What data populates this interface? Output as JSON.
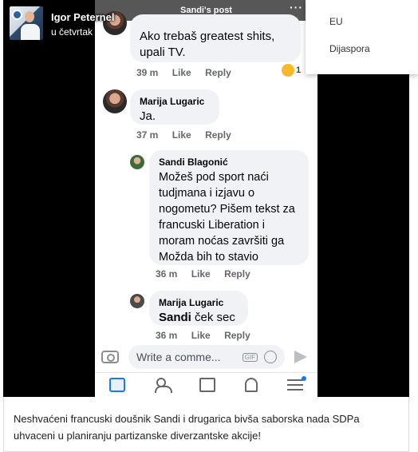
{
  "poster": {
    "name": "Igor Peternel",
    "time": "u četvrtak"
  },
  "phone": {
    "title": "Sandi's post",
    "more_icon": "···",
    "comments": [
      {
        "name": "",
        "text": "Ako trebaš greatest shits, upali TV.",
        "time": "39 m",
        "like": "Like",
        "reply": "Reply",
        "reaction_count": "1"
      },
      {
        "name": "Marija Lugaric",
        "text": "Ja.",
        "time": "37 m",
        "like": "Like",
        "reply": "Reply"
      },
      {
        "name": "Sandi Blagonić",
        "text": "Možeš pod sport naći tudjmana i izjavu o nogometu? Pišem tekst za francuski Liberation i moram noćas završiti ga Možda bih to stavio",
        "time": "36 m",
        "like": "Like",
        "reply": "Reply"
      },
      {
        "name": "Marija Lugaric",
        "text_bold": "Sandi",
        "text": " ček sec",
        "time": "36 m",
        "like": "Like",
        "reply": "Reply"
      }
    ],
    "composer_placeholder": "Write a comme...",
    "gif_label": "GIF"
  },
  "dropdown": {
    "items": [
      "EU",
      "Dijaspora"
    ]
  },
  "caption": "Neshvaćeni francuski doušnik Sandi i drugarica bivša saborska nada SDPa uhvaceni u planiranju partizanske diverzantske akcije!",
  "colors": {
    "accent": "#1877f2",
    "bubble": "#f0f2f5",
    "meta": "#65676b"
  }
}
